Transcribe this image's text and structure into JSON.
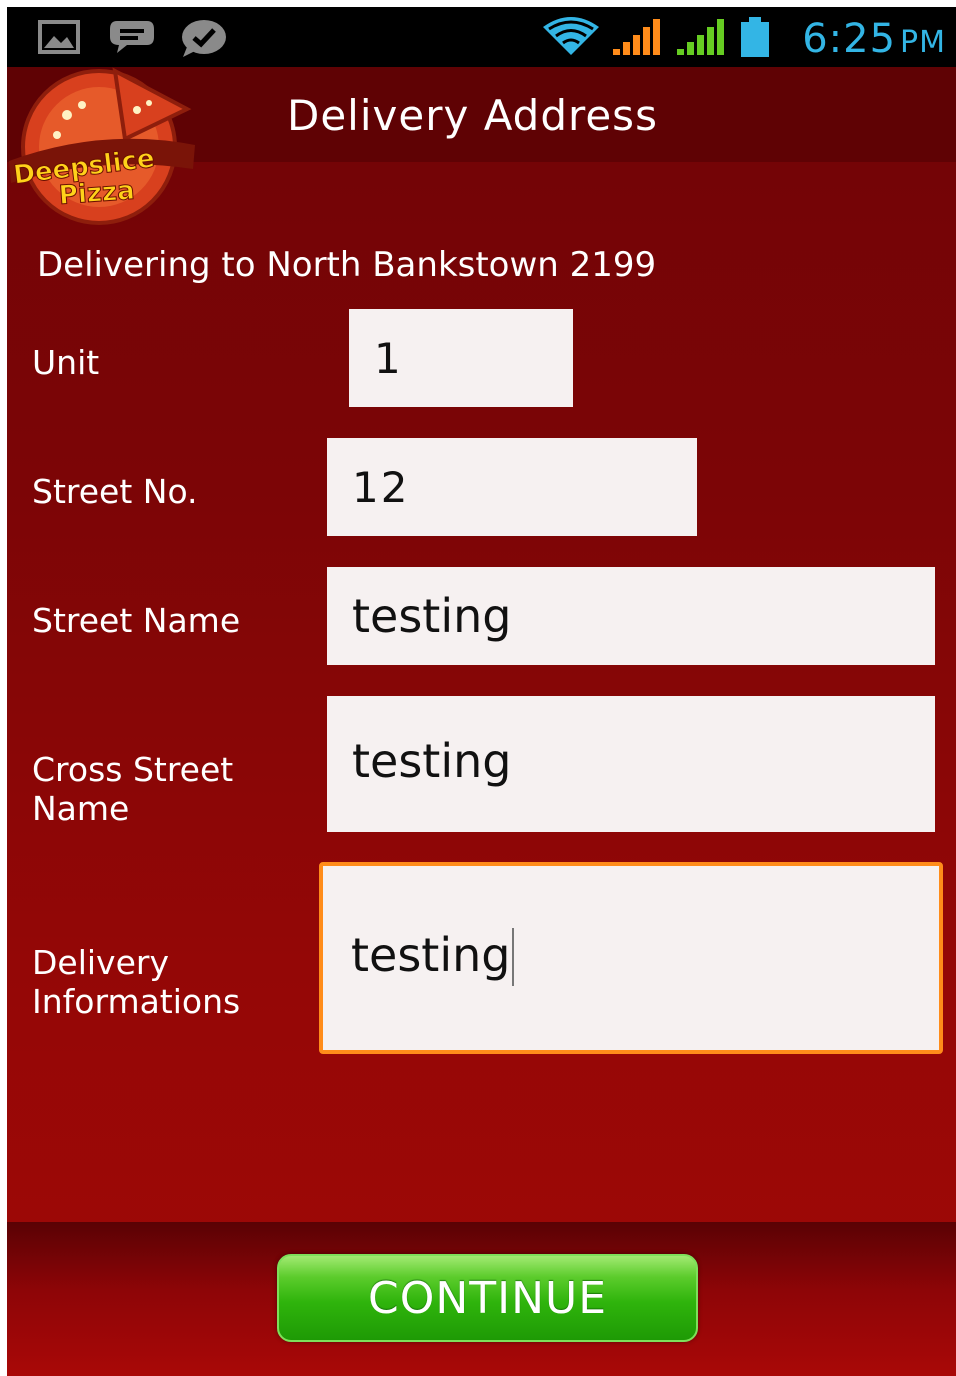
{
  "status_bar": {
    "time": "6:25",
    "ampm": "PM",
    "icons": [
      "gallery-icon",
      "chat-icon",
      "check-bubble-icon",
      "wifi-icon",
      "signal-icon",
      "signal-icon",
      "battery-icon"
    ],
    "clock_color": "#33b5e5"
  },
  "header": {
    "title": "Delivery Address",
    "logo_icon": "deepslice-pizza-logo"
  },
  "delivering_text": "Delivering to North Bankstown 2199",
  "form": {
    "unit": {
      "label": "Unit",
      "value": "1"
    },
    "street_no": {
      "label": "Street No.",
      "value": "12"
    },
    "street_name": {
      "label": "Street Name",
      "value": "testing"
    },
    "cross_street": {
      "label_line1": "Cross Street",
      "label_line2": "Name",
      "value": "testing"
    },
    "delivery_info": {
      "label_line1": "Delivery",
      "label_line2": "Informations",
      "value": "testing"
    }
  },
  "continue_label": "CONTINUE",
  "colors": {
    "background": "#8a0607",
    "header": "#5f0204",
    "focus_border": "#ff8c1a",
    "button": "#2fb40c"
  }
}
